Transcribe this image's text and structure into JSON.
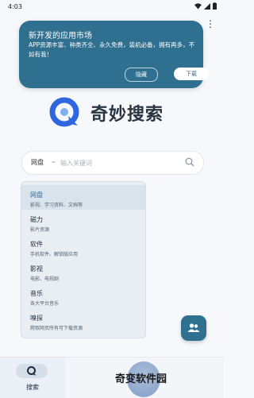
{
  "status_bar": {
    "time": "4:03"
  },
  "banner": {
    "title": "新开发的应用市场",
    "description": "APP资源丰富、种类齐全、永久免费，装机必备，拥有再多，不如有我！",
    "hide_label": "隐藏",
    "download_label": "下载"
  },
  "logo": {
    "text": "奇妙搜索"
  },
  "search": {
    "category": "网盘",
    "placeholder": "输入关键词"
  },
  "dropdown": {
    "items": [
      {
        "name": "网盘",
        "sub": "影视、学习资料、文档等",
        "selected": true
      },
      {
        "name": "磁力",
        "sub": "影片资源"
      },
      {
        "name": "软件",
        "sub": "手机软件、解锁版应用"
      },
      {
        "name": "影视",
        "sub": "电影、电视剧"
      },
      {
        "name": "音乐",
        "sub": "各大平台音乐"
      },
      {
        "name": "嗅探",
        "sub": "爬取网页所有可下载资源"
      }
    ]
  },
  "bottom_nav": {
    "search_label": "搜索"
  },
  "watermark": {
    "text": "奇变软件园"
  },
  "colors": {
    "accent": "#2f6f8f",
    "logo_blue": "#2f66e0"
  }
}
